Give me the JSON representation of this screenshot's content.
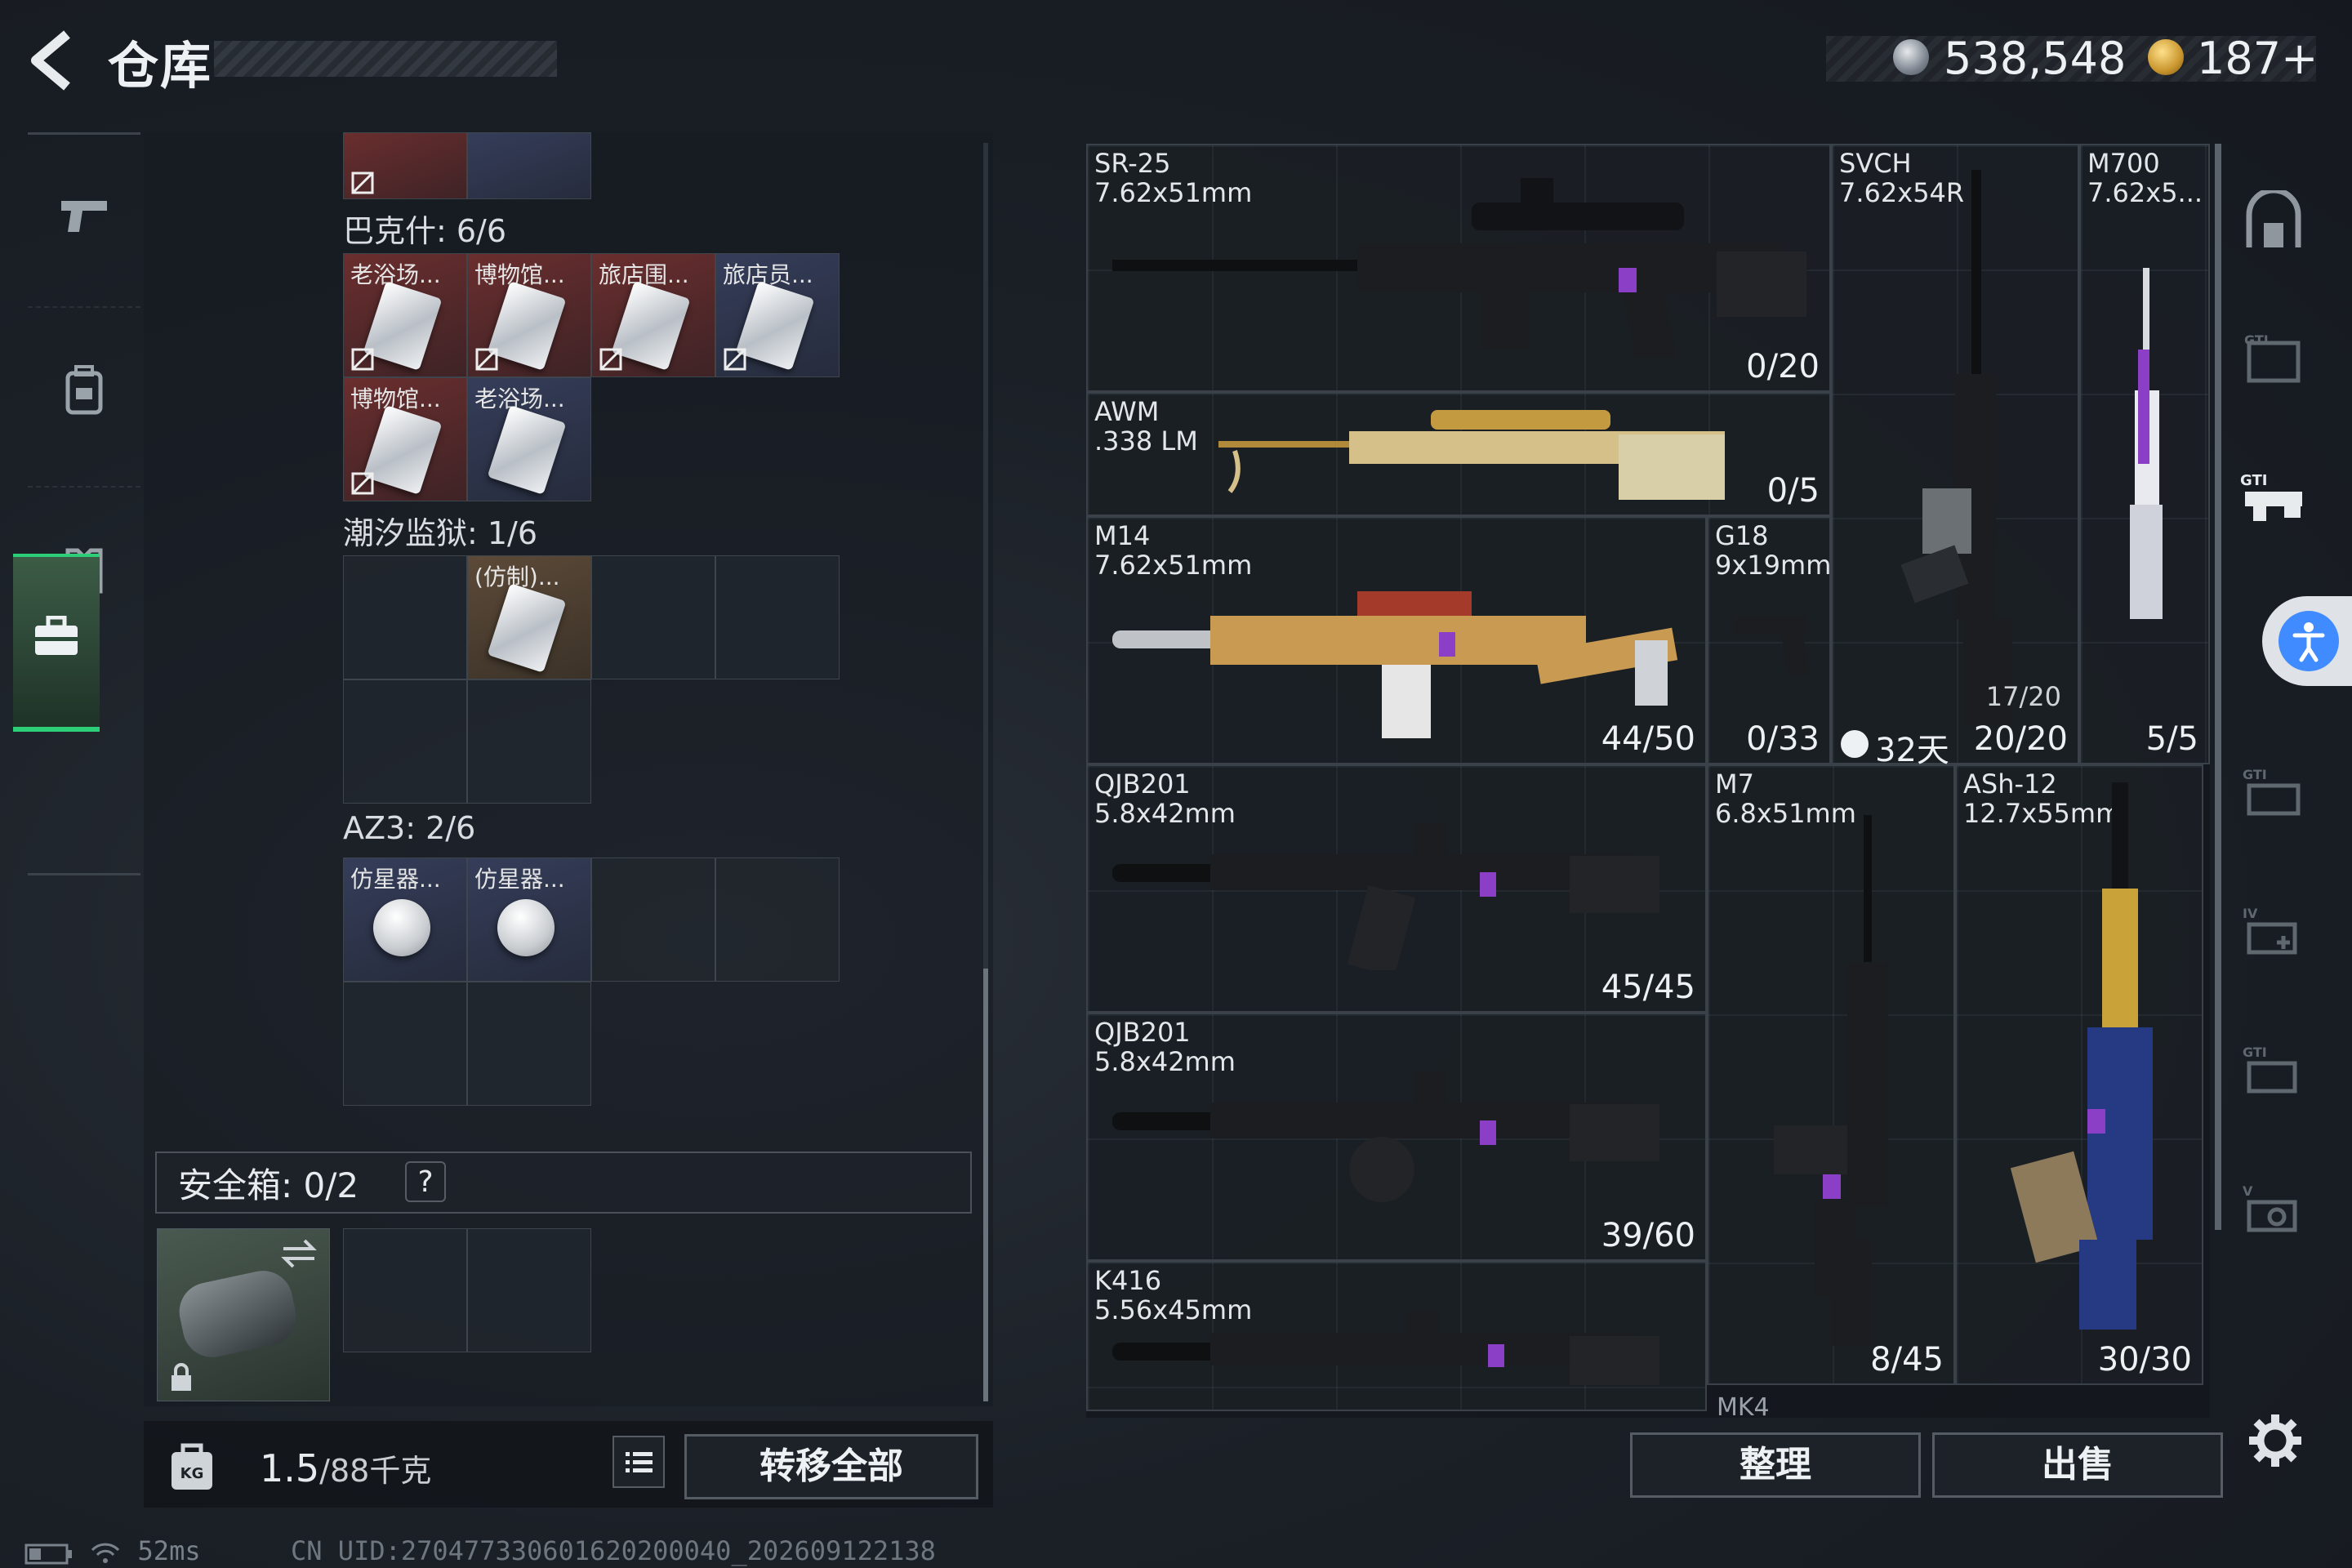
{
  "header": {
    "title": "仓库",
    "currency_silver": "538,548",
    "currency_gold": "187+"
  },
  "nav": {
    "items": [
      "weapons",
      "backpack",
      "armor",
      "gear"
    ],
    "active": "gear"
  },
  "inventory": {
    "top_partial_items": [
      "",
      ""
    ],
    "sections": [
      {
        "label": "巴克什: 6/6",
        "items": [
          {
            "name": "老浴场...",
            "rarity": "red",
            "blocked": true
          },
          {
            "name": "博物馆...",
            "rarity": "red",
            "blocked": true
          },
          {
            "name": "旅店围...",
            "rarity": "red",
            "blocked": true
          },
          {
            "name": "旅店员...",
            "rarity": "blue",
            "blocked": true
          },
          {
            "name": "博物馆...",
            "rarity": "red",
            "blocked": true
          },
          {
            "name": "老浴场...",
            "rarity": "blue",
            "blocked": false
          }
        ]
      },
      {
        "label": "潮汐监狱: 1/6",
        "items": [
          {
            "name": "(仿制)...",
            "rarity": "orange",
            "blocked": false
          }
        ]
      },
      {
        "label": "AZ3: 2/6",
        "items": [
          {
            "name": "仿星器...",
            "rarity": "blue",
            "blocked": false
          },
          {
            "name": "仿星器...",
            "rarity": "blue",
            "blocked": false
          }
        ]
      }
    ],
    "safe_box": {
      "label": "安全箱: 0/2",
      "help": "?"
    },
    "weight": "1.5",
    "weight_max": "/88千克",
    "transfer_all": "转移全部"
  },
  "weapons": [
    {
      "id": "sr25",
      "name": "SR-25\n7.62x51mm",
      "count": "0/20"
    },
    {
      "id": "svch",
      "name": "SVCH\n7.62x54R",
      "count": "20/20",
      "sub_count": "17/20"
    },
    {
      "id": "m700",
      "name": "M700\n7.62x5...",
      "count": "5/5"
    },
    {
      "id": "awm",
      "name": "AWM\n.338 LM",
      "count": "0/5"
    },
    {
      "id": "m14",
      "name": "M14\n7.62x51mm",
      "count": "44/50"
    },
    {
      "id": "g18",
      "name": "G18\n9x19mm",
      "count": "0/33"
    },
    {
      "id": "qjb201a",
      "name": "QJB201\n5.8x42mm",
      "count": "45/45"
    },
    {
      "id": "m7",
      "name": "M7\n6.8x51mm",
      "count": "8/45"
    },
    {
      "id": "ash12",
      "name": "ASh-12\n12.7x55mm",
      "count": "30/30"
    },
    {
      "id": "qjb201b",
      "name": "QJB201\n5.8x42mm",
      "count": "39/60"
    },
    {
      "id": "k416",
      "name": "K416\n5.56x45mm",
      "count": ""
    }
  ],
  "weapons_extra": {
    "mk4": "MK4",
    "timer": "32天"
  },
  "actions": {
    "sort": "整理",
    "sell": "出售"
  },
  "status_bar": {
    "ping": "52ms",
    "uid": "CN UID:270477330601620200040_202609122138"
  },
  "colors": {
    "accent_green": "#2ccf78",
    "access_blue": "#3f8bff",
    "rarity_red": "#6a2e2e",
    "rarity_blue": "#353d5a",
    "rarity_orange": "#5d4a38"
  }
}
